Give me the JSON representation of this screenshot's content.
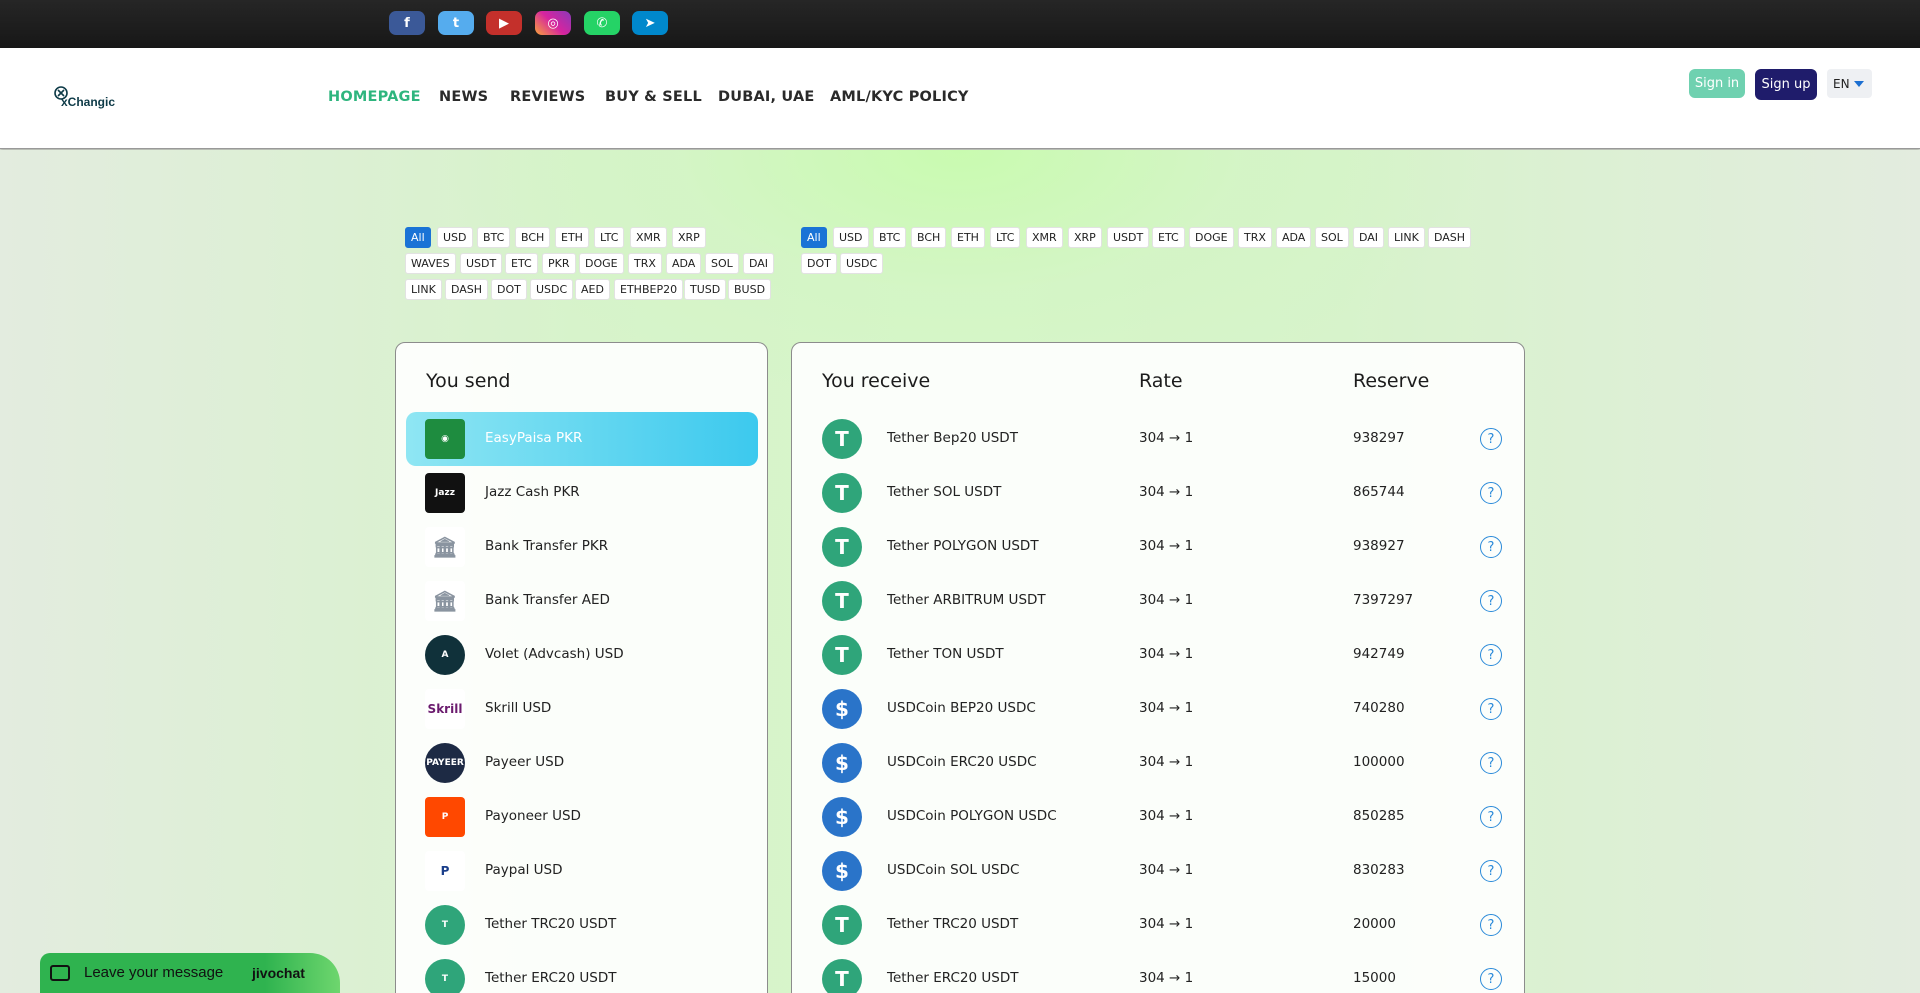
{
  "social": [
    {
      "name": "facebook",
      "glyph": "f",
      "color": "#3b5998"
    },
    {
      "name": "twitter",
      "glyph": "t",
      "color": "#55acee"
    },
    {
      "name": "youtube",
      "glyph": "▶",
      "color": "#c4302b"
    },
    {
      "name": "instagram",
      "glyph": "◎",
      "color": "#d6249f"
    },
    {
      "name": "whatsapp",
      "glyph": "✆",
      "color": "#25d366"
    },
    {
      "name": "telegram",
      "glyph": "➤",
      "color": "#0088cc"
    }
  ],
  "header": {
    "logo_text": "xChangic",
    "nav": [
      "HOMEPAGE",
      "NEWS",
      "REVIEWS",
      "BUY & SELL",
      "DUBAI, UAE",
      "AML/KYC POLICY"
    ],
    "signin": "Sign in",
    "signup": "Sign up",
    "lang": "EN"
  },
  "filters_send": [
    "All",
    "USD",
    "BTC",
    "BCH",
    "ETH",
    "LTC",
    "XMR",
    "XRP",
    "WAVES",
    "USDT",
    "ETC",
    "PKR",
    "DOGE",
    "TRX",
    "ADA",
    "SOL",
    "DAI",
    "LINK",
    "DASH",
    "DOT",
    "USDC",
    "AED",
    "ETHBEP20",
    "TUSD",
    "BUSD"
  ],
  "filters_receive": [
    "All",
    "USD",
    "BTC",
    "BCH",
    "ETH",
    "LTC",
    "XMR",
    "XRP",
    "USDT",
    "ETC",
    "DOGE",
    "TRX",
    "ADA",
    "SOL",
    "DAI",
    "LINK",
    "DASH",
    "DOT",
    "USDC"
  ],
  "send": {
    "title": "You send",
    "items": [
      {
        "label": "EasyPaisa PKR",
        "icon": "easypaisa-icon",
        "color": "#1e8c3f",
        "glyph": "◉"
      },
      {
        "label": "Jazz Cash PKR",
        "icon": "jazzcash-icon",
        "color": "#111111",
        "glyph": "Jazz"
      },
      {
        "label": "Bank Transfer PKR",
        "icon": "bank-icon",
        "color": "#ffffff",
        "glyph": "🏛"
      },
      {
        "label": "Bank Transfer AED",
        "icon": "bank-icon",
        "color": "#ffffff",
        "glyph": "🏛"
      },
      {
        "label": "Volet (Advcash) USD",
        "icon": "volet-icon",
        "color": "#10313a",
        "glyph": "A"
      },
      {
        "label": "Skrill USD",
        "icon": "skrill-icon",
        "color": "#ffffff",
        "glyph": "Skrill"
      },
      {
        "label": "Payeer USD",
        "icon": "payeer-icon",
        "color": "#1d2a44",
        "glyph": "PAYEER"
      },
      {
        "label": "Payoneer USD",
        "icon": "payoneer-icon",
        "color": "#ff4800",
        "glyph": "P"
      },
      {
        "label": "Paypal USD",
        "icon": "paypal-icon",
        "color": "#ffffff",
        "glyph": "P"
      },
      {
        "label": "Tether TRC20 USDT",
        "icon": "tether-icon",
        "color": "#2fa57a",
        "glyph": "T"
      },
      {
        "label": "Tether ERC20 USDT",
        "icon": "tether-icon",
        "color": "#2fa57a",
        "glyph": "T"
      }
    ]
  },
  "receive": {
    "title": "You receive",
    "rate_header": "Rate",
    "reserve_header": "Reserve",
    "rows": [
      {
        "name": "Tether Bep20 USDT",
        "rate": "304 → 1",
        "reserve": "938297",
        "type": "tether"
      },
      {
        "name": "Tether SOL USDT",
        "rate": "304 → 1",
        "reserve": "865744",
        "type": "tether"
      },
      {
        "name": "Tether POLYGON USDT",
        "rate": "304 → 1",
        "reserve": "938927",
        "type": "tether"
      },
      {
        "name": "Tether ARBITRUM USDT",
        "rate": "304 → 1",
        "reserve": "7397297",
        "type": "tether"
      },
      {
        "name": "Tether TON USDT",
        "rate": "304 → 1",
        "reserve": "942749",
        "type": "tether"
      },
      {
        "name": "USDCoin BEP20 USDC",
        "rate": "304 → 1",
        "reserve": "740280",
        "type": "usdc"
      },
      {
        "name": "USDCoin ERC20 USDC",
        "rate": "304 → 1",
        "reserve": "100000",
        "type": "usdc"
      },
      {
        "name": "USDCoin POLYGON USDC",
        "rate": "304 → 1",
        "reserve": "850285",
        "type": "usdc"
      },
      {
        "name": "USDCoin SOL USDC",
        "rate": "304 → 1",
        "reserve": "830283",
        "type": "usdc"
      },
      {
        "name": "Tether TRC20 USDT",
        "rate": "304 → 1",
        "reserve": "20000",
        "type": "tether"
      },
      {
        "name": "Tether ERC20 USDT",
        "rate": "304 → 1",
        "reserve": "15000",
        "type": "tether"
      }
    ]
  },
  "chat": {
    "message": "Leave your message",
    "brand": "jivochat"
  }
}
